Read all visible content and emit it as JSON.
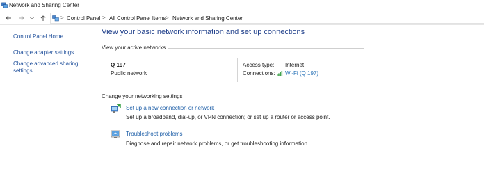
{
  "window": {
    "title": "Network and Sharing Center",
    "icon": "network-sharing-icon"
  },
  "nav": {
    "back_icon": "back-arrow-icon",
    "forward_icon": "forward-arrow-icon",
    "recent_icon": "chevron-down-icon",
    "up_icon": "up-arrow-icon",
    "separator": ">",
    "breadcrumbs": [
      "Control Panel",
      "All Control Panel Items",
      "Network and Sharing Center"
    ]
  },
  "sidebar": {
    "items": [
      {
        "label": "Control Panel Home"
      },
      {
        "label": "Change adapter settings"
      },
      {
        "label": "Change advanced sharing"
      },
      {
        "label": "settings"
      }
    ]
  },
  "main": {
    "heading": "View your basic network information and set up connections",
    "active_networks": {
      "label": "View your active networks",
      "network_name": "Q 197",
      "network_type": "Public network",
      "access_type_label": "Access type:",
      "access_type_value": "Internet",
      "connections_label": "Connections:",
      "connection_value": "Wi-Fi (Q 197)",
      "connection_icon": "wifi-signal-icon"
    },
    "networking_settings": {
      "label": "Change your networking settings",
      "tasks": [
        {
          "title": "Set up a new connection or network",
          "description": "Set up a broadband, dial-up, or VPN connection; or set up a router or access point.",
          "icon": "new-connection-icon"
        },
        {
          "title": "Troubleshoot problems",
          "description": "Diagnose and repair network problems, or get troubleshooting information.",
          "icon": "troubleshoot-icon"
        }
      ]
    }
  },
  "colors": {
    "link": "#1e5fa8",
    "heading": "#1e3e8a",
    "divider": "#cfcfcf"
  }
}
